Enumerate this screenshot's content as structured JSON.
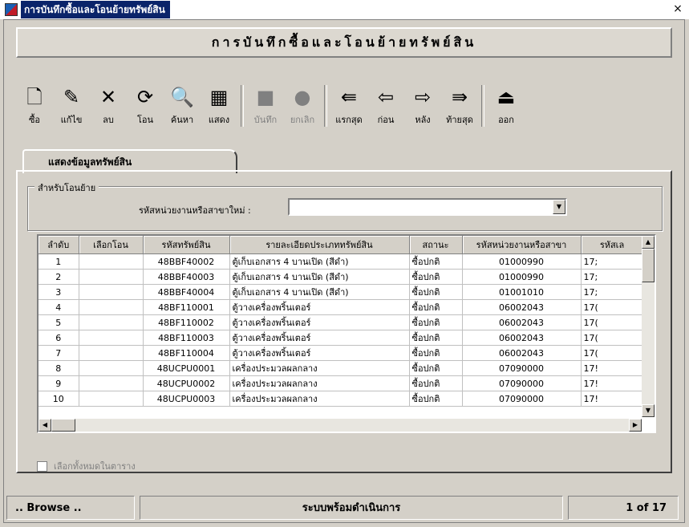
{
  "window": {
    "title": "การบันทึกซื้อและโอนย้ายทรัพย์สิน",
    "close_glyph": "×"
  },
  "banner": {
    "text": "การบันทึกซื้อและโอนย้ายทรัพย์สิน"
  },
  "toolbar": {
    "buttons": [
      {
        "label": "ซื้อ",
        "icon": "new-document-icon",
        "glyph": "🗋",
        "enabled": true
      },
      {
        "label": "แก้ไข",
        "icon": "edit-icon",
        "glyph": "✎",
        "enabled": true
      },
      {
        "label": "ลบ",
        "icon": "delete-x-icon",
        "glyph": "✕",
        "enabled": true
      },
      {
        "label": "โอน",
        "icon": "transfer-icon",
        "glyph": "⟳",
        "enabled": true
      },
      {
        "label": "ค้นหา",
        "icon": "binoculars-icon",
        "glyph": "🔍",
        "enabled": true
      },
      {
        "label": "แสดง",
        "icon": "grid-view-icon",
        "glyph": "▦",
        "enabled": true
      },
      {
        "label": "บันทึก",
        "icon": "save-icon",
        "glyph": "■",
        "enabled": false
      },
      {
        "label": "ยกเลิก",
        "icon": "cancel-icon",
        "glyph": "●",
        "enabled": false
      },
      {
        "label": "แรกสุด",
        "icon": "first-icon",
        "glyph": "⇚",
        "enabled": true
      },
      {
        "label": "ก่อน",
        "icon": "previous-icon",
        "glyph": "⇦",
        "enabled": true
      },
      {
        "label": "หลัง",
        "icon": "next-icon",
        "glyph": "⇨",
        "enabled": true
      },
      {
        "label": "ท้ายสุด",
        "icon": "last-icon",
        "glyph": "⇛",
        "enabled": true
      },
      {
        "label": "ออก",
        "icon": "exit-door-icon",
        "glyph": "⏏",
        "enabled": true
      }
    ]
  },
  "tab": {
    "label": "แสดงข้อมูลทรัพย์สิน"
  },
  "transfer_group": {
    "legend": "สำหรับโอนย้าย",
    "field_label": "รหัสหน่วยงานหรือสาขาใหม่ :",
    "field_value": ""
  },
  "grid": {
    "columns": [
      "ลำดับ",
      "เลือกโอน",
      "รหัสทรัพย์สิน",
      "รายละเอียดประเภททรัพย์สิน",
      "สถานะ",
      "รหัสหน่วยงานหรือสาขา",
      "รหัสเล"
    ],
    "rows": [
      [
        "1",
        "",
        "48BBF40002",
        "ตู้เก็บเอกสาร 4 บานเปิด (สีดำ)",
        "ซื้อปกติ",
        "01000990",
        "17;"
      ],
      [
        "2",
        "",
        "48BBF40003",
        "ตู้เก็บเอกสาร 4 บานเปิด (สีดำ)",
        "ซื้อปกติ",
        "01000990",
        "17;"
      ],
      [
        "3",
        "",
        "48BBF40004",
        "ตู้เก็บเอกสาร 4 บานเปิด (สีดำ)",
        "ซื้อปกติ",
        "01001010",
        "17;"
      ],
      [
        "4",
        "",
        "48BF110001",
        "ตู้วางเครื่องพริ้นเตอร์",
        "ซื้อปกติ",
        "06002043",
        "17("
      ],
      [
        "5",
        "",
        "48BF110002",
        "ตู้วางเครื่องพริ้นเตอร์",
        "ซื้อปกติ",
        "06002043",
        "17("
      ],
      [
        "6",
        "",
        "48BF110003",
        "ตู้วางเครื่องพริ้นเตอร์",
        "ซื้อปกติ",
        "06002043",
        "17("
      ],
      [
        "7",
        "",
        "48BF110004",
        "ตู้วางเครื่องพริ้นเตอร์",
        "ซื้อปกติ",
        "06002043",
        "17("
      ],
      [
        "8",
        "",
        "48UCPU0001",
        "เครื่องประมวลผลกลาง",
        "ซื้อปกติ",
        "07090000",
        "17!"
      ],
      [
        "9",
        "",
        "48UCPU0002",
        "เครื่องประมวลผลกลาง",
        "ซื้อปกติ",
        "07090000",
        "17!"
      ],
      [
        "10",
        "",
        "48UCPU0003",
        "เครื่องประมวลผลกลาง",
        "ซื้อปกติ",
        "07090000",
        "17!"
      ]
    ]
  },
  "select_all": {
    "label": "เลือกทั้งหมดในตาราง"
  },
  "statusbar": {
    "left": ".. Browse ..",
    "center": "ระบบพร้อมดำเนินการ",
    "right": "1 of 17"
  }
}
